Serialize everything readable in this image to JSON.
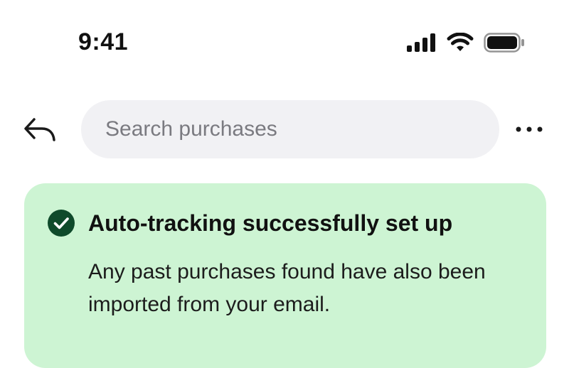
{
  "status_bar": {
    "time": "9:41",
    "icons": [
      "signal-icon",
      "wifi-icon",
      "battery-icon"
    ]
  },
  "top_bar": {
    "back_icon": "back-arrow-icon",
    "search": {
      "placeholder": "Search purchases",
      "value": ""
    },
    "more_icon": "more-horizontal-icon"
  },
  "banner": {
    "icon": "check-circle-icon",
    "title": "Auto-tracking successfully set up",
    "body": "Any past purchases found have also been imported from your email."
  },
  "colors": {
    "banner_background": "#cdf4d3",
    "check_icon": "#0f4a2b",
    "search_background": "#f1f1f4",
    "text_primary": "#111111",
    "placeholder": "#7a7a80"
  }
}
